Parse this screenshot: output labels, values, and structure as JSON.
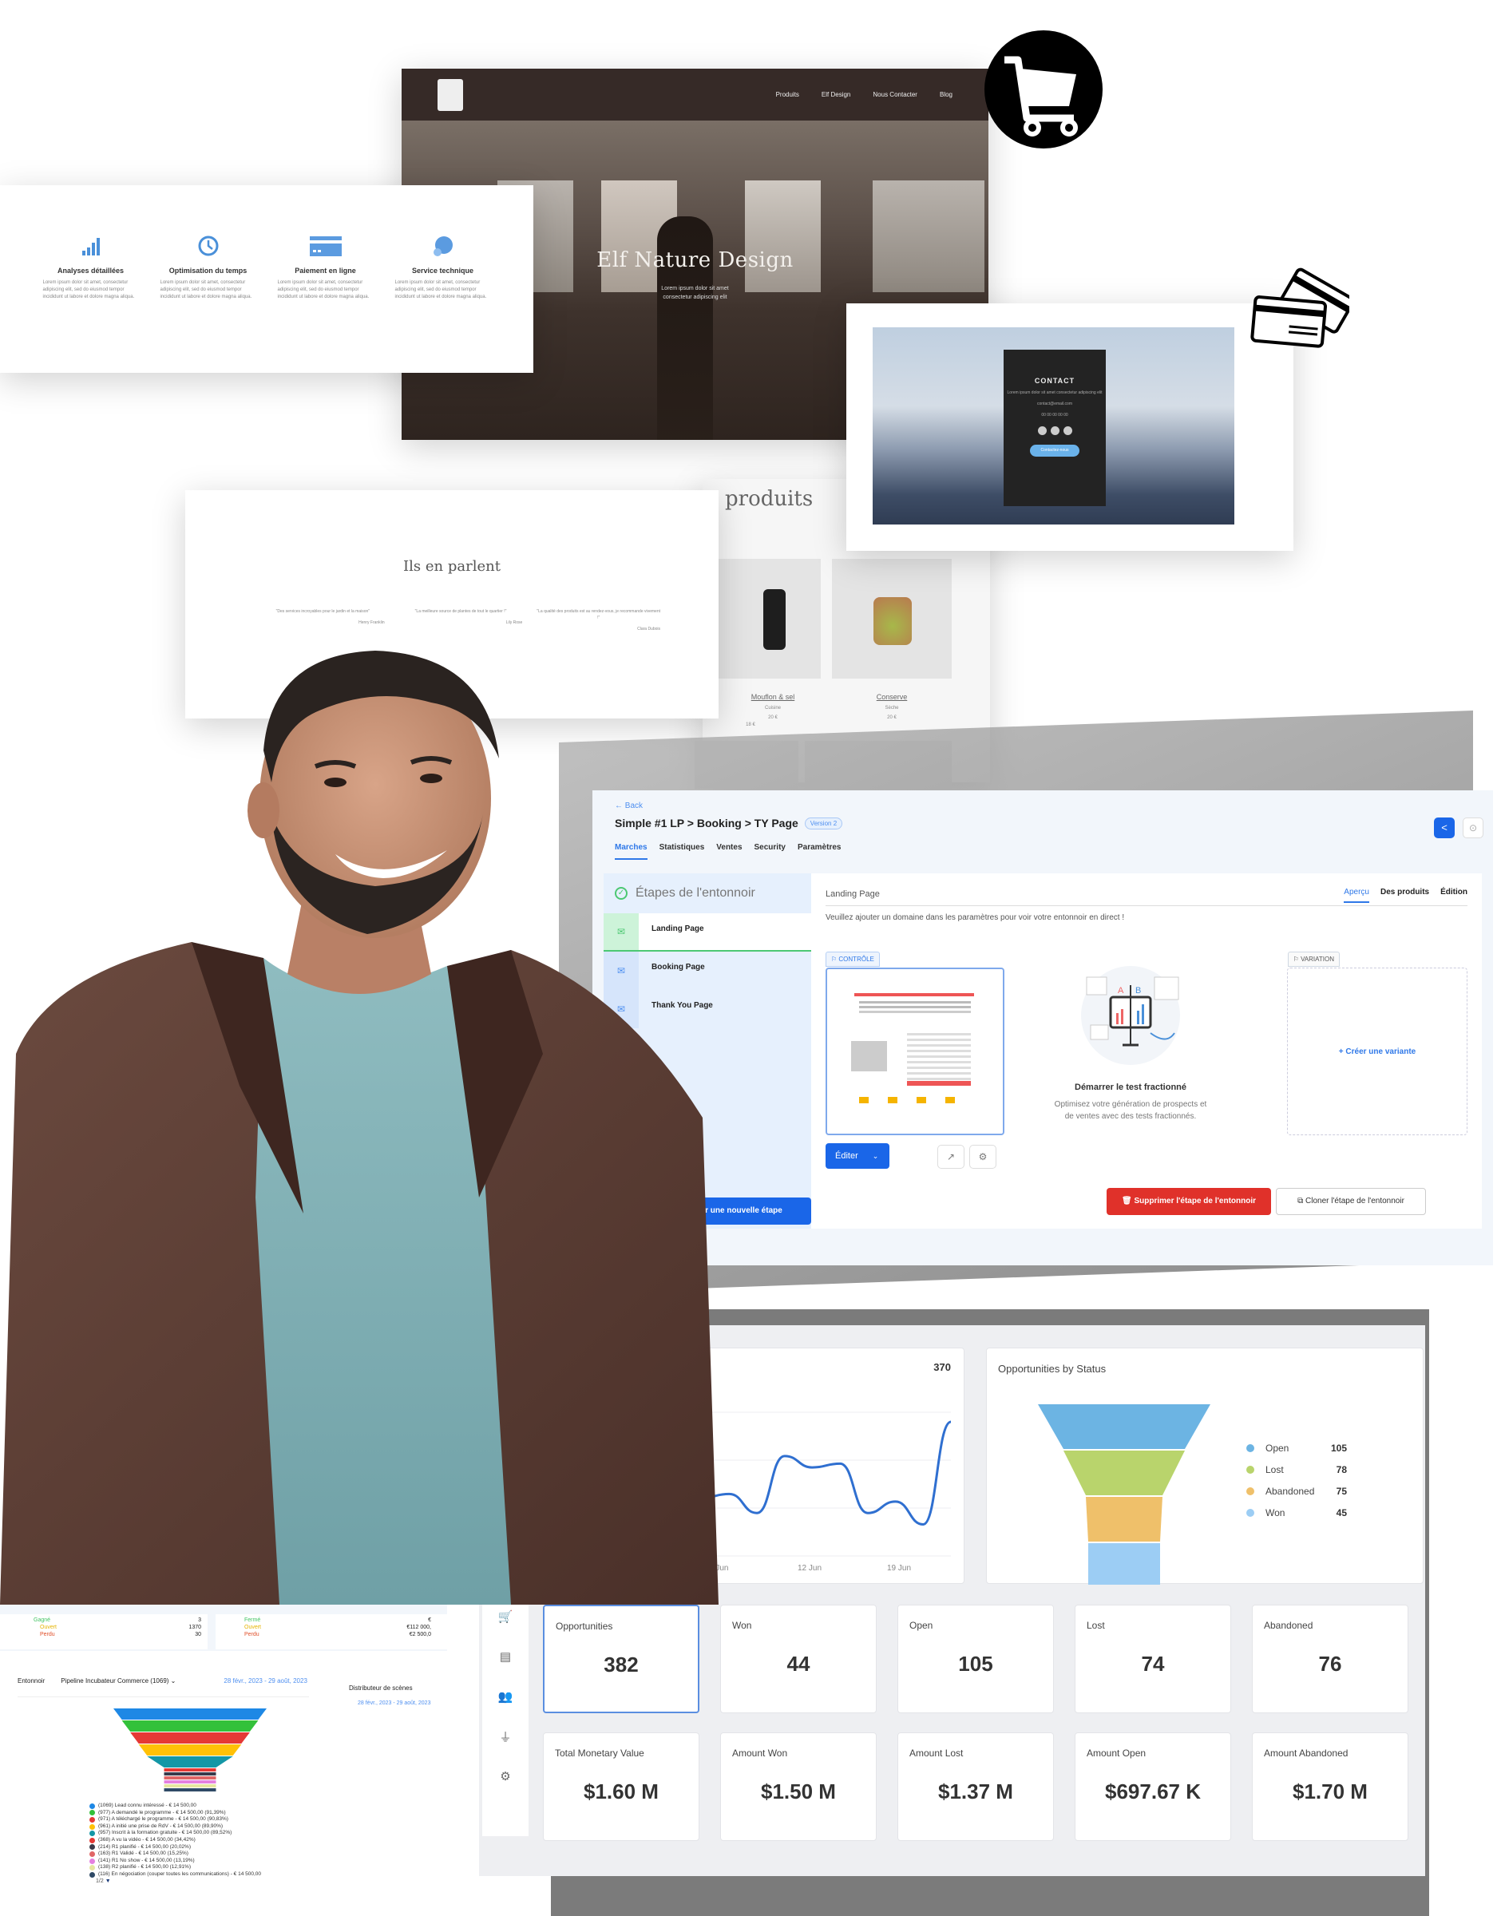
{
  "website_hero": {
    "nav": [
      "Produits",
      "Elf Design",
      "Nous Contacter",
      "Blog"
    ],
    "title": "Elf Nature Design",
    "subtitle_lines": [
      "Lorem ipsum dolor sit amet",
      "consectetur adipiscing elit"
    ]
  },
  "features": [
    {
      "icon": "bar-chart-icon",
      "title": "Analyses détaillées",
      "text": "Lorem ipsum dolor sit amet, consectetur adipiscing elit, sed do eiusmod tempor incididunt ut labore et dolore magna aliqua."
    },
    {
      "icon": "clock-icon",
      "title": "Optimisation du temps",
      "text": "Lorem ipsum dolor sit amet, consectetur adipiscing elit, sed do eiusmod tempor incididunt ut labore et dolore magna aliqua."
    },
    {
      "icon": "credit-card-icon",
      "title": "Paiement en ligne",
      "text": "Lorem ipsum dolor sit amet, consectetur adipiscing elit, sed do eiusmod tempor incididunt ut labore et dolore magna aliqua."
    },
    {
      "icon": "support-icon",
      "title": "Service technique",
      "text": "Lorem ipsum dolor sit amet, consectetur adipiscing elit, sed do eiusmod tempor incididunt ut labore et dolore magna aliqua."
    }
  ],
  "contact": {
    "title": "CONTACT",
    "text": "Lorem ipsum dolor sit amet consectetur adipiscing elit",
    "email": "contact@email.com",
    "phone": "00 00 00 00 00",
    "button": "Contactez-nous"
  },
  "products": {
    "heading": "produits",
    "items": [
      {
        "name": "Mouflon & sel",
        "category": "Cuisine",
        "price": "20 €"
      },
      {
        "name": "Conserve",
        "category": "Sèche",
        "price": "20 €"
      }
    ],
    "price_single": "18 €"
  },
  "testimonials": {
    "heading": "Ils en parlent",
    "quotes": [
      {
        "text": "\"Des services incroyables pour le jardin et la maison\"",
        "author": "Henry Franklin"
      },
      {
        "text": "\"La meilleure source de plantes de tout le quartier !\"",
        "author": "Lily Rose"
      },
      {
        "text": "\"La qualité des produits est au rendez-vous, je recommande vivement !\"",
        "author": "Clara Dubois"
      }
    ]
  },
  "editor": {
    "back": "← Back",
    "title": "Simple #1 LP > Booking > TY Page",
    "version": "Version 2",
    "tabs": [
      "Marches",
      "Statistiques",
      "Ventes",
      "Security",
      "Paramètres"
    ],
    "steps_title": "Étapes de l'entonnoir",
    "steps": [
      "Landing Page",
      "Booking Page",
      "Thank You Page"
    ],
    "add_step": "Ajouter une nouvelle étape",
    "page_title": "Landing Page",
    "subtabs": [
      "Aperçu",
      "Des produits",
      "Édition"
    ],
    "warning": "Veuillez ajouter un domaine dans les paramètres pour voir votre entonnoir en direct !",
    "control_label": "CONTRÔLE",
    "variation_label": "VARIATION",
    "edit_button": "Éditer",
    "ab_title": "Démarrer le test fractionné",
    "ab_text_1": "Optimisez votre génération de prospects et",
    "ab_text_2": "de ventes avec des tests fractionnés.",
    "create_variant": "+ Créer une variante",
    "delete_step": "Supprimer l'étape de l'entonnoir",
    "clone_step": "Cloner l'étape de l'entonnoir"
  },
  "dashboard": {
    "line_max_label": "370",
    "kpis_row1": [
      {
        "label": "Opportunities",
        "value": "382"
      },
      {
        "label": "Won",
        "value": "44"
      },
      {
        "label": "Open",
        "value": "105"
      },
      {
        "label": "Lost",
        "value": "74"
      },
      {
        "label": "Abandoned",
        "value": "76"
      }
    ],
    "kpis_row2": [
      {
        "label": "Total Monetary Value",
        "value": "$1.60 M"
      },
      {
        "label": "Amount Won",
        "value": "$1.50 M"
      },
      {
        "label": "Amount Lost",
        "value": "$1.37 M"
      },
      {
        "label": "Amount Open",
        "value": "$697.67 K"
      },
      {
        "label": "Amount Abandoned",
        "value": "$1.70 M"
      }
    ],
    "rail_icons": [
      "cart-icon",
      "document-icon",
      "users-icon",
      "plug-icon",
      "gear-icon"
    ]
  },
  "chart_data": [
    {
      "type": "line",
      "title": "",
      "x": [
        "~1 Jun",
        "",
        "",
        "",
        "",
        "5 Jun",
        "",
        "",
        "",
        "",
        "",
        "",
        "12 Jun",
        "",
        "",
        "",
        "",
        "",
        "",
        "19 Jun",
        "",
        "",
        "",
        ""
      ],
      "xticks": [
        "5 Jun",
        "12 Jun",
        "19 Jun"
      ],
      "values": [
        300,
        230,
        140,
        300,
        290,
        270,
        170,
        170,
        170,
        180,
        130,
        280,
        250,
        260,
        130,
        160,
        100,
        370
      ],
      "annotation": "370",
      "color": "#2f6fd0"
    },
    {
      "type": "funnel",
      "title": "Opportunities by Status",
      "categories": [
        "Open",
        "Lost",
        "Abandoned",
        "Won"
      ],
      "values": [
        105,
        78,
        75,
        45
      ],
      "colors": [
        "#6cb4e3",
        "#b9d46c",
        "#efc06a",
        "#9ccdf4"
      ],
      "legend": "right"
    },
    {
      "type": "funnel",
      "title": "Entonnoir",
      "pipeline": "Pipeline Incubateur Commerce (1069)",
      "date_range": "28 févr., 2023 - 29 août, 2023",
      "categories": [
        "(1069) Lead connu intéressé - € 14 500,00",
        "(977) A demandé le programme - € 14 500,00 (91,39%)",
        "(971) A téléchargé le programme - € 14 500,00 (90,83%)",
        "(961) A initié une prise de RdV - € 14 500,00 (89,90%)",
        "(957) Inscrit à la formation gratuite - € 14 500,00 (89,52%)",
        "(368) A vu la vidéo - € 14 500,00 (34,42%)",
        "(214) R1 planifié - € 14 500,00 (20,02%)",
        "(163) R1 Validé - € 14 500,00 (15,25%)",
        "(141) R1 No show - € 14 500,00 (13,19%)",
        "(138) R2 planifié - € 14 500,00 (12,91%)",
        "(116) En négociation (couper toutes les communications) - € 14 500,00"
      ],
      "values": [
        1069,
        977,
        971,
        961,
        957,
        368,
        214,
        163,
        141,
        138,
        116
      ],
      "colors": [
        "#1e88e5",
        "#33c13a",
        "#e53935",
        "#ffc107",
        "#1497a6",
        "#e53935",
        "#3a3a4a",
        "#e06666",
        "#e580e0",
        "#e6e6a0",
        "#2f4a66"
      ],
      "page": "1/2"
    }
  ],
  "pipeline_summary": {
    "left": [
      {
        "label": "Gagné",
        "value": "3",
        "color": "#43c463"
      },
      {
        "label": "Ouvert",
        "value": "1370",
        "color": "#e5b400"
      },
      {
        "label": "Perdu",
        "value": "30",
        "color": "#e0502a"
      }
    ],
    "right": [
      {
        "label": "Fermé",
        "value": "€",
        "color": "#43c463"
      },
      {
        "label": "Ouvert",
        "value": "€112 000,",
        "color": "#e5b400"
      },
      {
        "label": "Perdu",
        "value": "€2 500,0",
        "color": "#e0502a"
      }
    ],
    "entonnoir_label": "Entonnoir",
    "distributor_label": "Distributeur de scènes",
    "distributor_date": "28 févr., 2023 - 29 août, 2023"
  }
}
